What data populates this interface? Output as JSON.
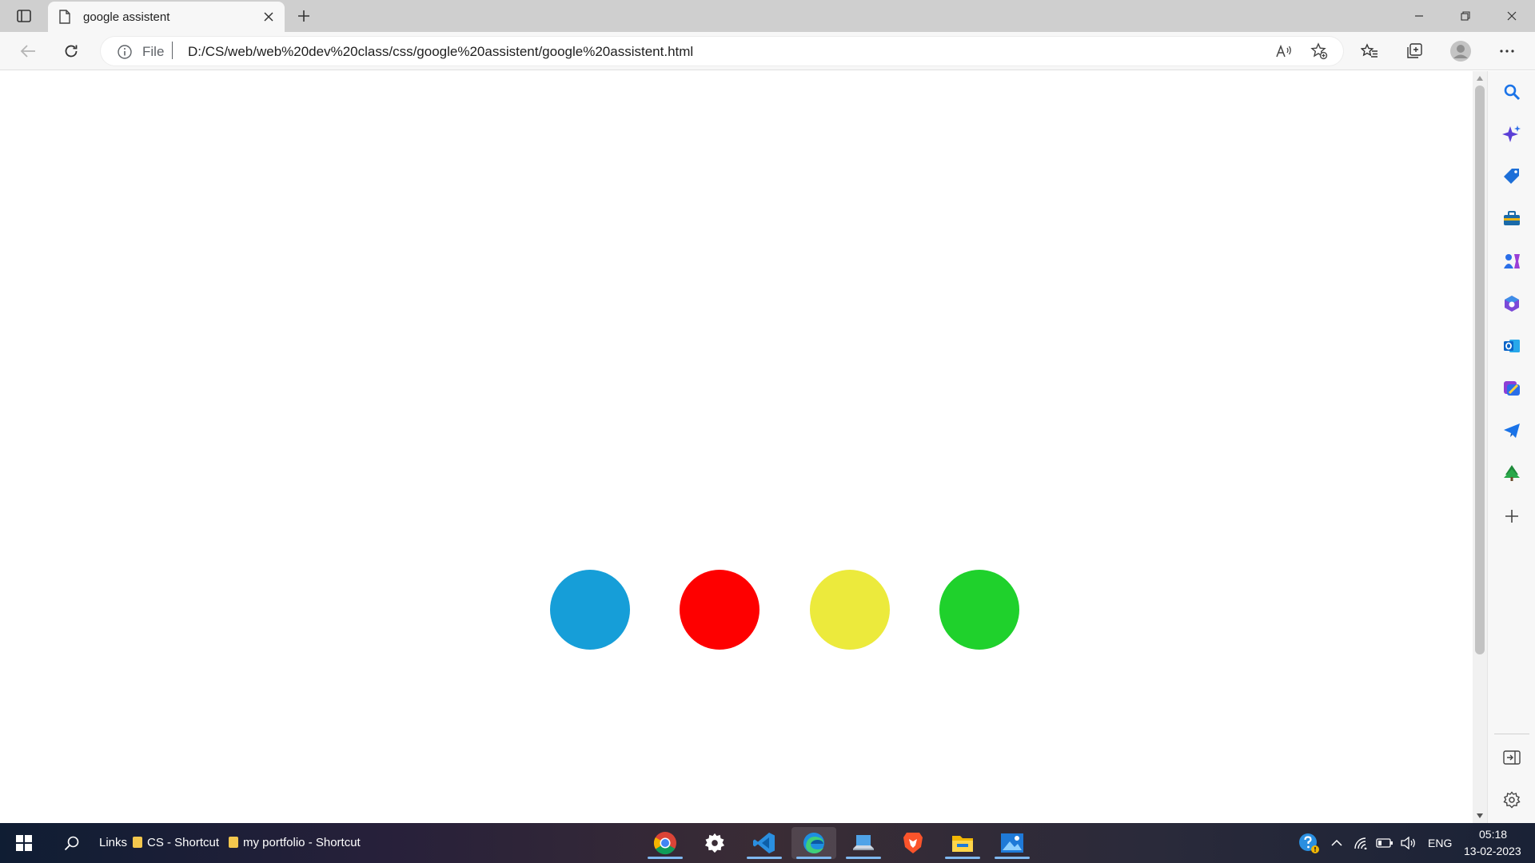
{
  "browser": {
    "tab_title": "google assistent",
    "address_scheme": "File",
    "url": "D:/CS/web/web%20dev%20class/css/google%20assistent/google%20assistent.html"
  },
  "page": {
    "dots": [
      {
        "name": "blue-dot",
        "color": "#169ed8"
      },
      {
        "name": "red-dot",
        "color": "#fe0000"
      },
      {
        "name": "yellow-dot",
        "color": "#ecea3c"
      },
      {
        "name": "green-dot",
        "color": "#1fd12c"
      }
    ]
  },
  "sidebar": {
    "icons": [
      "search-icon",
      "copilot-icon",
      "shopping-icon",
      "tools-icon",
      "games-icon",
      "office-icon",
      "outlook-icon",
      "designer-icon",
      "telegram-icon",
      "tree-icon",
      "add-icon",
      "hide-sidebar-icon",
      "settings-icon"
    ]
  },
  "taskbar": {
    "links_label": "Links",
    "shortcuts": [
      "CS - Shortcut",
      "my portfolio - Shortcut"
    ],
    "apps": [
      "chrome-icon",
      "settings-icon",
      "vscode-icon",
      "edge-icon",
      "laptop-app-icon",
      "brave-icon",
      "file-explorer-icon",
      "photos-icon"
    ],
    "language": "ENG",
    "time": "05:18",
    "date": "13-02-2023"
  }
}
